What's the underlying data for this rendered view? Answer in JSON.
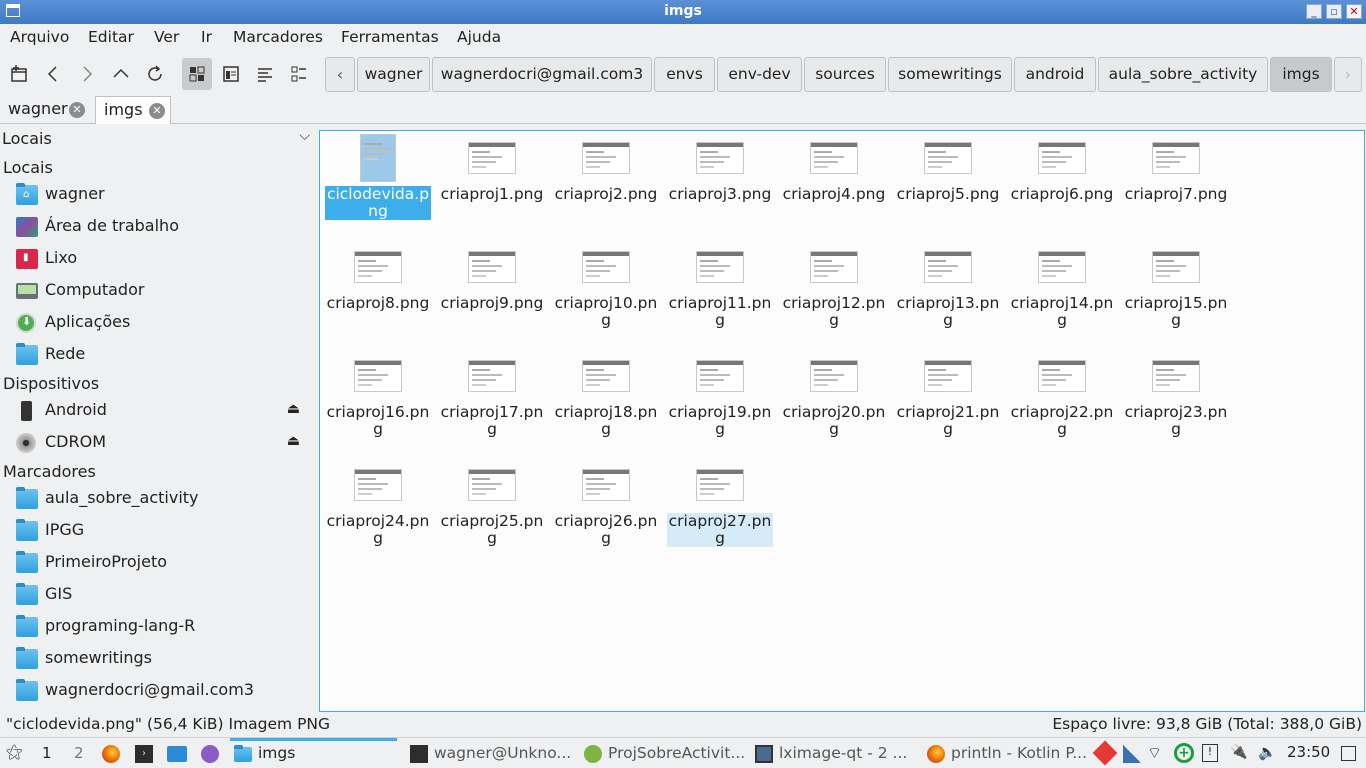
{
  "window": {
    "title": "imgs"
  },
  "menu": [
    "Arquivo",
    "Editar",
    "Ver",
    "Ir",
    "Marcadores",
    "Ferramentas",
    "Ajuda"
  ],
  "breadcrumb": [
    "wagner",
    "wagnerdocri@gmail.com3",
    "envs",
    "env-dev",
    "sources",
    "somewritings",
    "android",
    "aula_sobre_activity",
    "imgs"
  ],
  "tabs": [
    {
      "label": "wagner"
    },
    {
      "label": "imgs"
    }
  ],
  "sidebar": {
    "combo_label": "Locais",
    "sections": {
      "locais": "Locais",
      "dispositivos": "Dispositivos",
      "marcadores": "Marcadores"
    },
    "places": [
      "wagner",
      "Área de trabalho",
      "Lixo",
      "Computador",
      "Aplicações",
      "Rede"
    ],
    "devices": [
      "Android",
      "CDROM"
    ],
    "bookmarks": [
      "aula_sobre_activity",
      "IPGG",
      "PrimeiroProjeto",
      "GIS",
      "programing-lang-R",
      "somewritings",
      "wagnerdocri@gmail.com3"
    ]
  },
  "files": [
    "ciclodevida.png",
    "criaproj1.png",
    "criaproj2.png",
    "criaproj3.png",
    "criaproj4.png",
    "criaproj5.png",
    "criaproj6.png",
    "criaproj7.png",
    "criaproj8.png",
    "criaproj9.png",
    "criaproj10.png",
    "criaproj11.png",
    "criaproj12.png",
    "criaproj13.png",
    "criaproj14.png",
    "criaproj15.png",
    "criaproj16.png",
    "criaproj17.png",
    "criaproj18.png",
    "criaproj19.png",
    "criaproj20.png",
    "criaproj21.png",
    "criaproj22.png",
    "criaproj23.png",
    "criaproj24.png",
    "criaproj25.png",
    "criaproj26.png",
    "criaproj27.png"
  ],
  "selected_file": "ciclodevida.png",
  "hovered_file": "criaproj27.png",
  "status": {
    "left": "\"ciclodevida.png\" (56,4 KiB) Imagem PNG",
    "right": "Espaço livre: 93,8 GiB (Total: 388,0 GiB)"
  },
  "taskbar": {
    "desktops": [
      "1",
      "2"
    ],
    "tasks": [
      {
        "label": "imgs",
        "icon": "folder-icon"
      },
      {
        "label": "wagner@Unkno...",
        "icon": "terminal-icon"
      },
      {
        "label": "ProjSobreActivit...",
        "icon": "android-studio-icon"
      },
      {
        "label": "lximage-qt - 2 ...",
        "icon": "image-viewer-icon"
      },
      {
        "label": "println - Kotlin P...",
        "icon": "firefox-icon"
      }
    ],
    "clock": "23:50"
  },
  "colors": {
    "accent": "#3daee9",
    "titlebar": "#4a86cf"
  }
}
